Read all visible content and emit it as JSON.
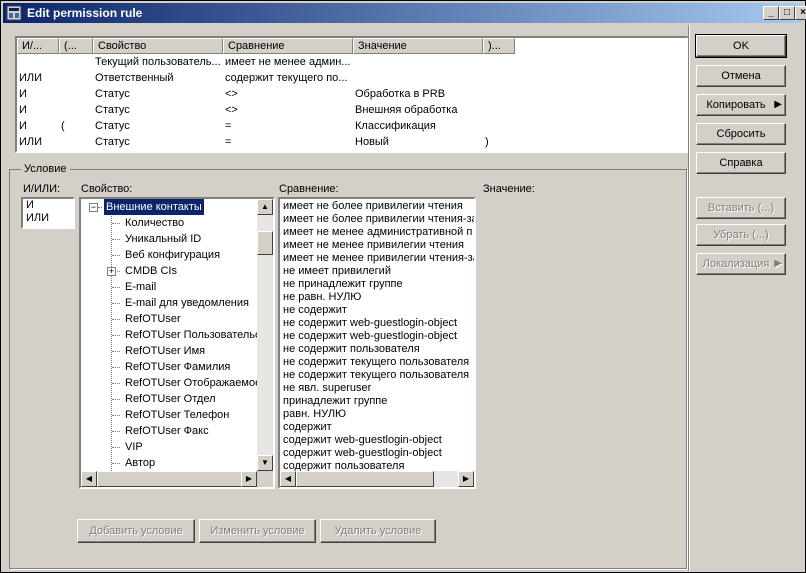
{
  "window": {
    "title": "Edit permission rule",
    "minimize": "_",
    "maximize": "□",
    "close": "×"
  },
  "rules_table": {
    "headers": [
      "И/...",
      "(...",
      "Свойство",
      "Сравнение",
      "Значение",
      ")..."
    ],
    "rows": [
      {
        "op": "",
        "open": "",
        "prop": "Текущий пользователь...",
        "cmp": "имеет не менее админ...",
        "val": "",
        "close": ""
      },
      {
        "op": "ИЛИ",
        "open": "",
        "prop": "Ответственный",
        "cmp": "содержит текущего по...",
        "val": "",
        "close": ""
      },
      {
        "op": "И",
        "open": "",
        "prop": "Статус",
        "cmp": "<>",
        "val": "Обработка в PRB",
        "close": ""
      },
      {
        "op": "И",
        "open": "",
        "prop": "Статус",
        "cmp": "<>",
        "val": "Внешняя обработка",
        "close": ""
      },
      {
        "op": "И",
        "open": "(",
        "prop": "Статус",
        "cmp": "=",
        "val": "Классификация",
        "close": ""
      },
      {
        "op": "ИЛИ",
        "open": "",
        "prop": "Статус",
        "cmp": "=",
        "val": "Новый",
        "close": ")"
      }
    ]
  },
  "buttons": {
    "ok": "OK",
    "cancel": "Отмена",
    "copy": "Копировать",
    "reset": "Сбросить",
    "help": "Справка",
    "insert": "Вставить (...)",
    "remove": "Убрать (...)",
    "localization": "Локализация",
    "add_condition": "Добавить условие",
    "change_condition": "Изменить условие",
    "delete_condition": "Удалить условие"
  },
  "condition": {
    "group_label": "Условие",
    "andor_label": "И/ИЛИ:",
    "andor_options": [
      "И",
      "ИЛИ"
    ],
    "property_label": "Свойство:",
    "comparison_label": "Сравнение:",
    "value_label": "Значение:",
    "tree": {
      "root": "Внешние контакты",
      "children": [
        "Количество",
        "Уникальный ID",
        "Веб конфигурация",
        "CMDB CIs",
        "E-mail",
        "E-mail для уведомления",
        "RefOTUser",
        "RefOTUser Пользовательс",
        "RefOTUser Имя",
        "RefOTUser Фамилия",
        "RefOTUser Отображаемое",
        "RefOTUser Отдел",
        "RefOTUser Телефон",
        "RefOTUser Факс",
        "VIP",
        "Автор"
      ]
    },
    "comparisons": [
      "имеет не более привилегии чтения",
      "имеет не более привилегии чтения-за",
      "имеет не менее административной п",
      "имеет не менее привилегии чтения",
      "имеет не менее привилегии чтения-за",
      "не имеет привилегий",
      "не принадлежит группе",
      "не равн. НУЛЮ",
      "не содержит",
      "не содержит web-guestlogin-object",
      "не содержит web-guestlogin-object",
      "не содержит пользователя",
      "не содержит текущего пользователя",
      "не содержит текущего пользователя",
      "не явл. superuser",
      "принадлежит группе",
      "равн. НУЛЮ",
      "содержит",
      "содержит web-guestlogin-object",
      "содержит web-guestlogin-object",
      "содержит пользователя"
    ]
  }
}
